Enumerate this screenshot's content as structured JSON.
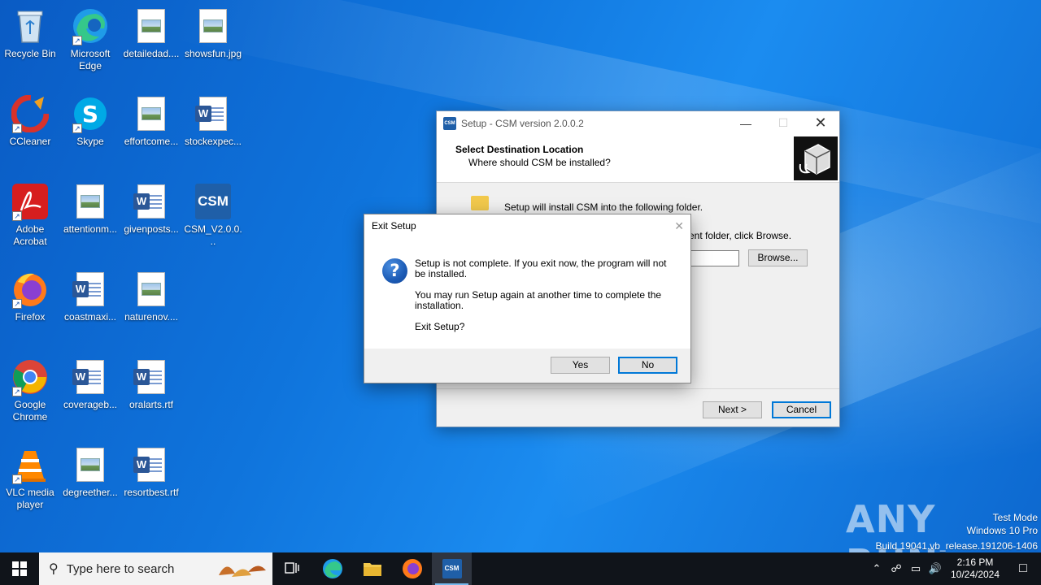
{
  "desktop": {
    "icons": [
      {
        "label": "Recycle Bin"
      },
      {
        "label": "Microsoft Edge"
      },
      {
        "label": "detailedad...."
      },
      {
        "label": "showsfun.jpg"
      },
      {
        "label": "CCleaner"
      },
      {
        "label": "Skype"
      },
      {
        "label": "effortcome..."
      },
      {
        "label": "stockexpec..."
      },
      {
        "label": "Adobe Acrobat"
      },
      {
        "label": "attentionm..."
      },
      {
        "label": "givenposts..."
      },
      {
        "label": "CSM_V2.0.0..."
      },
      {
        "label": "Firefox"
      },
      {
        "label": "coastmaxi..."
      },
      {
        "label": "naturenov...."
      },
      {
        "label": "Google Chrome"
      },
      {
        "label": "coverageb..."
      },
      {
        "label": "oralarts.rtf"
      },
      {
        "label": "VLC media player"
      },
      {
        "label": "degreether..."
      },
      {
        "label": "resortbest.rtf"
      }
    ]
  },
  "setup_window": {
    "title": "Setup - CSM version 2.0.0.2",
    "heading": "Select Destination Location",
    "subheading": "Where should CSM be installed?",
    "install_line": "Setup will install CSM into the following folder.",
    "browse_line": "ent folder, click Browse.",
    "path_value": "",
    "browse_button": "Browse...",
    "next_button": "Next >",
    "cancel_button": "Cancel",
    "app_icon_text": "CSM"
  },
  "exit_dialog": {
    "title": "Exit Setup",
    "message1": "Setup is not complete. If you exit now, the program will not be installed.",
    "message2": "You may run Setup again at another time to complete the installation.",
    "message3": "Exit Setup?",
    "yes_button": "Yes",
    "no_button": "No"
  },
  "watermark": {
    "text": "ANY RUN",
    "mode": "Test Mode",
    "edition": "Windows 10 Pro",
    "build": "Build 19041.vb_release.191206-1406"
  },
  "taskbar": {
    "search_placeholder": "Type here to search",
    "time": "2:16 PM",
    "date": "10/24/2024",
    "active_app": "CSM"
  },
  "colors": {
    "accent": "#0078d7",
    "taskbar": "#10141a",
    "desktop": "#1273d6"
  }
}
